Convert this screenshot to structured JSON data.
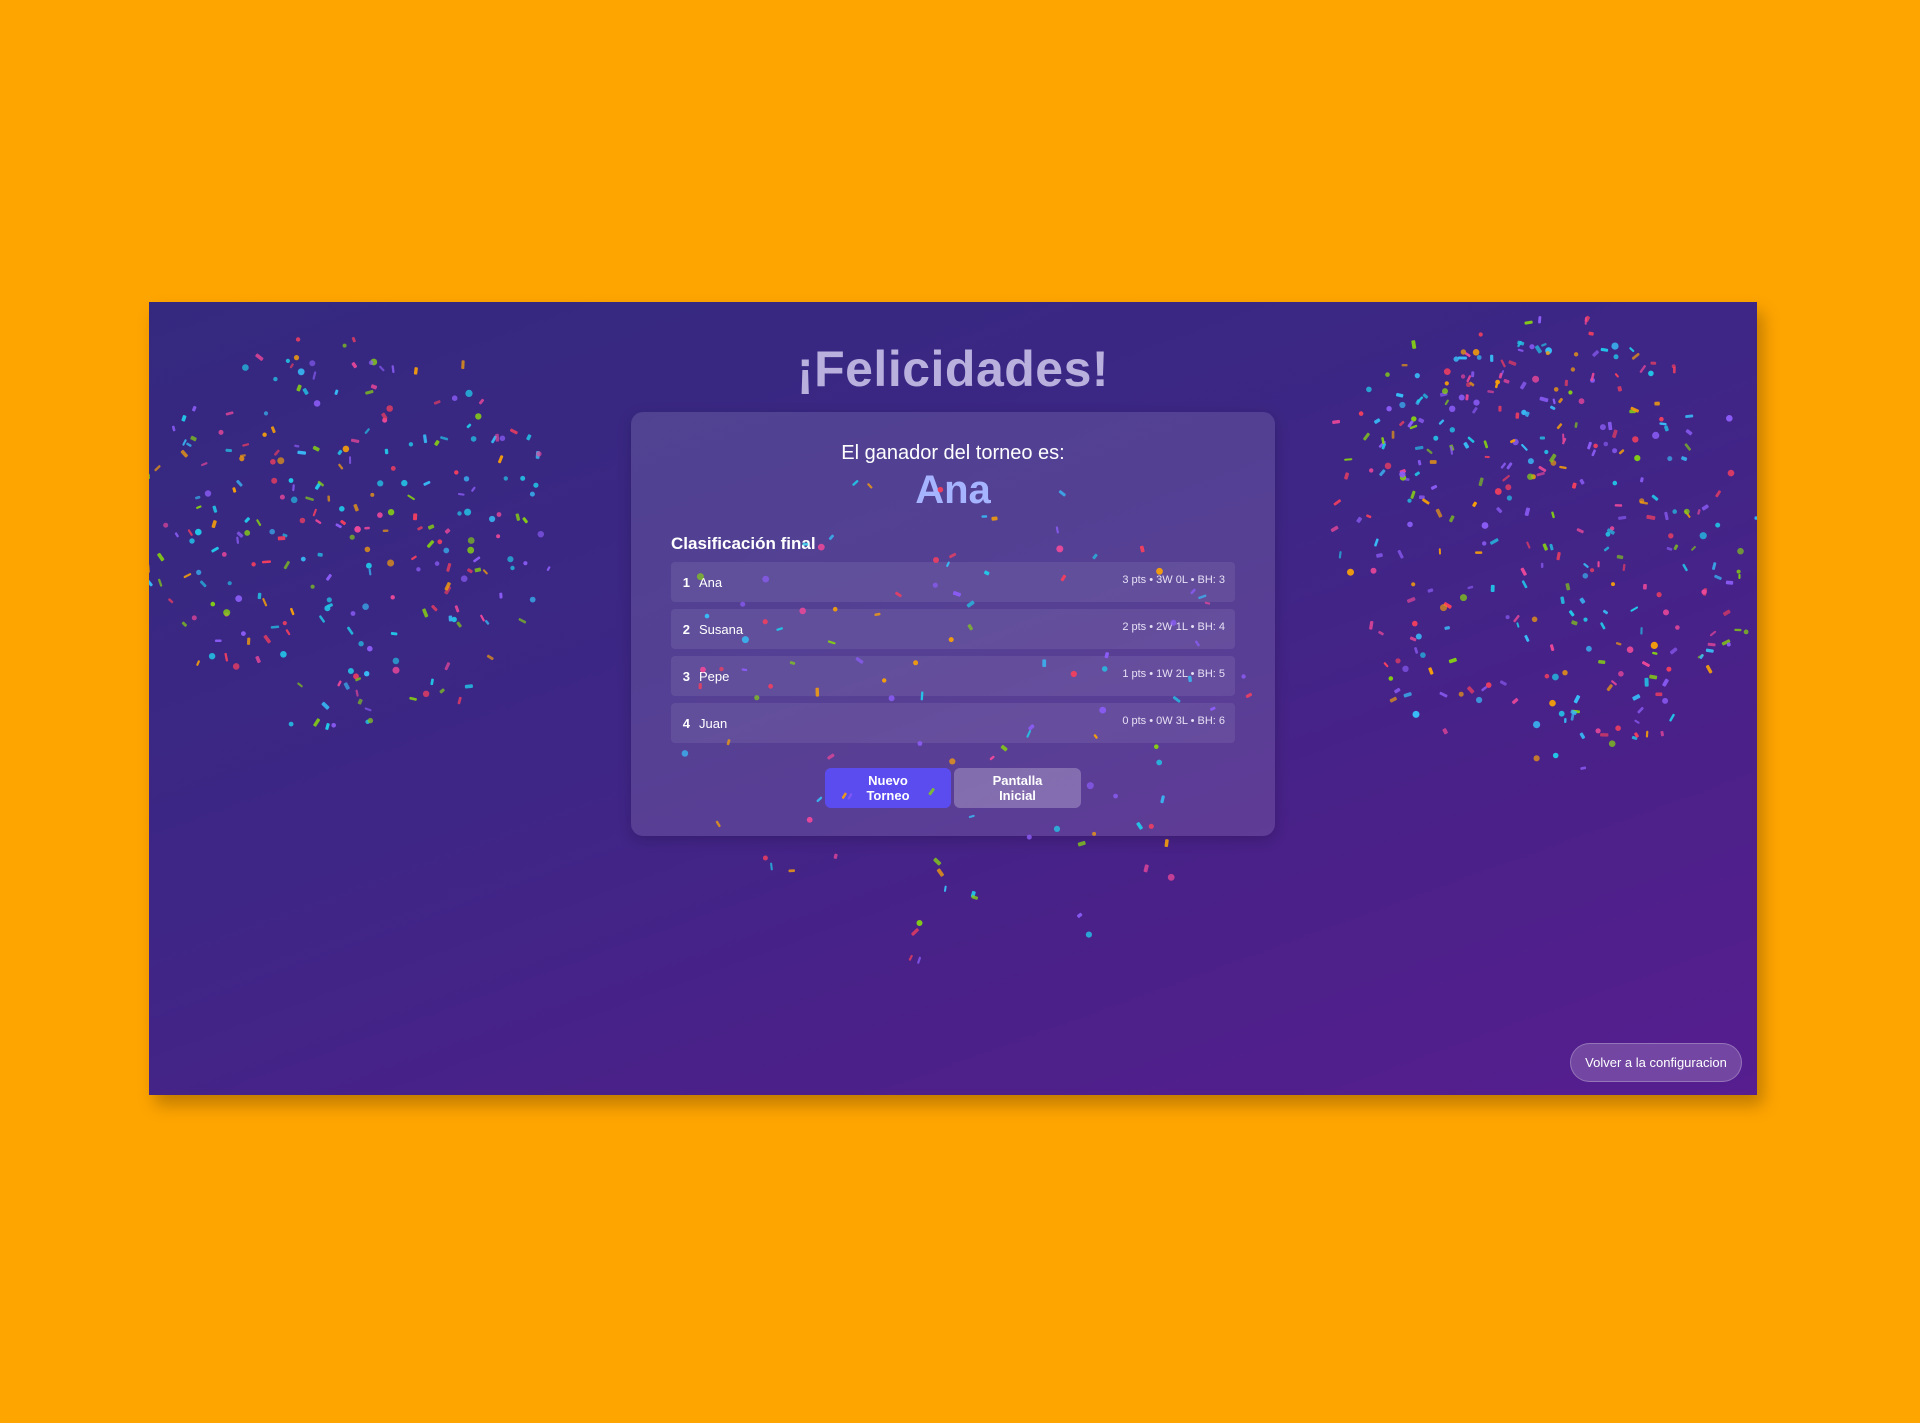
{
  "header": {
    "title": "¡Felicidades!"
  },
  "winner": {
    "label": "El ganador del torneo es:",
    "name": "Ana"
  },
  "standings": {
    "title": "Clasificación final",
    "rows": [
      {
        "rank": "1",
        "name": "Ana",
        "stats": "3 pts • 3W 0L • BH: 3"
      },
      {
        "rank": "2",
        "name": "Susana",
        "stats": "2 pts • 2W 1L • BH: 4"
      },
      {
        "rank": "3",
        "name": "Pepe",
        "stats": "1 pts • 1W 2L • BH: 5"
      },
      {
        "rank": "4",
        "name": "Juan",
        "stats": "0 pts • 0W 3L • BH: 6"
      }
    ]
  },
  "actions": {
    "new_tournament": "Nuevo Torneo",
    "home_screen": "Pantalla Inicial",
    "back_to_config": "Volver a la configuracion"
  },
  "colors": {
    "page_background": "#FFA500",
    "accent_button": "#5b4cf0",
    "winner_name": "#a6b4ff",
    "confetti": [
      "#22c7e8",
      "#8b5cf6",
      "#ec4899",
      "#f43f5e",
      "#84cc16",
      "#f59e0b",
      "#38bdf8"
    ]
  }
}
